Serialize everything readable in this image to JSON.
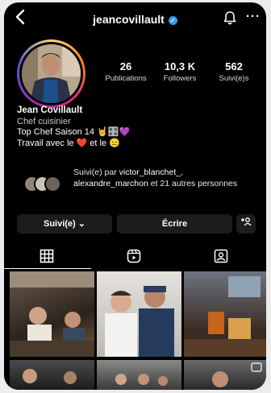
{
  "header": {
    "username": "jeancovillault",
    "back_icon": "chevron-left-icon",
    "verified_icon": "verified-badge-icon",
    "bell_icon": "bell-icon",
    "more_icon": "more-horizontal-icon",
    "more_label": "···"
  },
  "stats": [
    {
      "value": "26",
      "label": "Publications"
    },
    {
      "value": "10,3 K",
      "label": "Followers"
    },
    {
      "value": "562",
      "label": "Suivi(e)s"
    }
  ],
  "bio": {
    "name": "Jean Covillault",
    "category": "Chef cuisinier",
    "line1": "Top Chef Saison 14 🤘🎛️💜",
    "line2": "Travail avec le ❤️ et le 😑"
  },
  "followed_by": {
    "prefix": "Suivi(e) par ",
    "user1": "victor_blanchet_",
    "sep": ",",
    "user2": "alexandre_marchon",
    "suffix": " et 21 autres personnes"
  },
  "actions": {
    "follow_label": "Suivi(e) ⌄",
    "message_label": "Écrire",
    "suggest_label": "+👤"
  },
  "tabs": {
    "grid_icon": "grid-icon",
    "reels_icon": "reels-icon",
    "tagged_icon": "tagged-icon"
  },
  "colors": {
    "background": "#000000",
    "button": "#1c1c1c",
    "verified": "#3b97f0"
  }
}
